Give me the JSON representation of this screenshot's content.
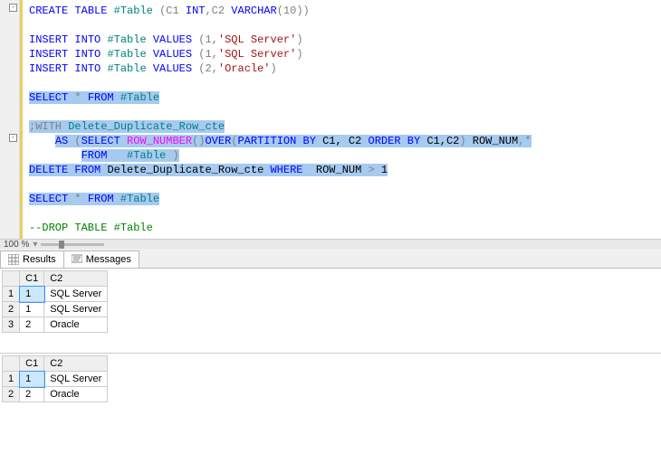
{
  "zoom": "100 %",
  "collapse_glyph": "-",
  "tabs": {
    "results": "Results",
    "messages": "Messages"
  },
  "code": {
    "l1_create": "CREATE",
    "l1_table": "TABLE",
    "l1_name": "#Table",
    "l1_cols": "(C1 ",
    "l1_int": "INT",
    "l1_mid": ",C2 ",
    "l1_varchar": "VARCHAR",
    "l1_len": "(10))",
    "ins": "INSERT",
    "into": "INTO",
    "values": "VALUES",
    "tbl": "#Table",
    "v1": "(1,",
    "sql_str": "'SQL Server'",
    "vclose": ")",
    "v2": "(2,",
    "oracle_str": "'Oracle'",
    "select": "SELECT",
    "star_from": "* ",
    "from": "FROM",
    "with": ";WITH",
    "cte_name": "Delete_Duplicate_Row_cte",
    "as": "AS",
    "open": "(",
    "rn": "ROW_NUMBER",
    "over": "OVER",
    "part": "PARTITION",
    "by": "BY",
    "part_cols": "C1, C2 ",
    "order": "ORDER",
    "ord_cols": "C1,C2",
    "rownum_alias": "ROW_NUM",
    "star": ",*",
    "close": ")",
    "delete": "DELETE",
    "where": "WHERE",
    "gt": ">",
    "one": "1",
    "drop_cmt": "--DROP TABLE #Table"
  },
  "grid1": {
    "headers": [
      "",
      "C1",
      "C2"
    ],
    "rows": [
      [
        "1",
        "1",
        "SQL Server"
      ],
      [
        "2",
        "1",
        "SQL Server"
      ],
      [
        "3",
        "2",
        "Oracle"
      ]
    ]
  },
  "grid2": {
    "headers": [
      "",
      "C1",
      "C2"
    ],
    "rows": [
      [
        "1",
        "1",
        "SQL Server"
      ],
      [
        "2",
        "2",
        "Oracle"
      ]
    ]
  }
}
